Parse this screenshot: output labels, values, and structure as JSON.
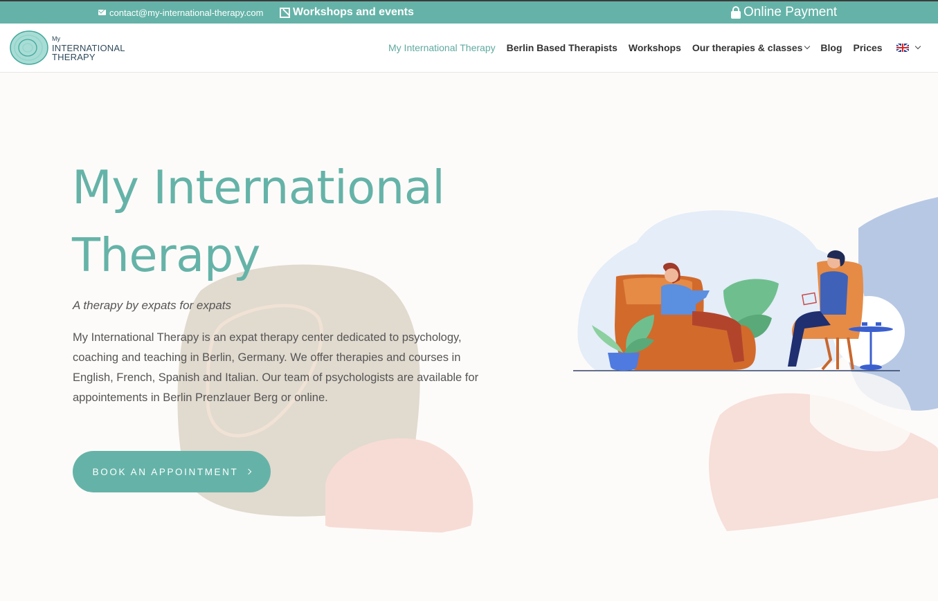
{
  "topbar": {
    "email": "contact@my-international-therapy.com",
    "workshops": "Workshops and events",
    "payment": "Online Payment"
  },
  "logo": {
    "line1": "My",
    "line2": "INTERNATIONAL",
    "line3": "THERAPY"
  },
  "nav": {
    "items": [
      {
        "label": "My International Therapy"
      },
      {
        "label": "Berlin Based Therapists"
      },
      {
        "label": "Workshops"
      },
      {
        "label": "Our therapies & classes"
      },
      {
        "label": "Blog"
      },
      {
        "label": "Prices"
      }
    ],
    "language_icon": "uk-flag-icon"
  },
  "hero": {
    "title": "My International Therapy",
    "tagline": "A therapy by expats for expats",
    "description": "My International Therapy is an expat therapy center dedicated to psychology, coaching and teaching in Berlin, Germany. We offer therapies and courses in English, French, Spanish and Italian. Our team of psychologists are available for appointements in Berlin Prenzlauer Berg or online.",
    "cta": "BOOK AN APPOINTMENT"
  },
  "colors": {
    "accent": "#65b3a8",
    "text": "#555555",
    "beige_blob": "#dcd3c8",
    "pink_blob": "#f6dcd6",
    "blue_blob": "#b7c8e4"
  }
}
